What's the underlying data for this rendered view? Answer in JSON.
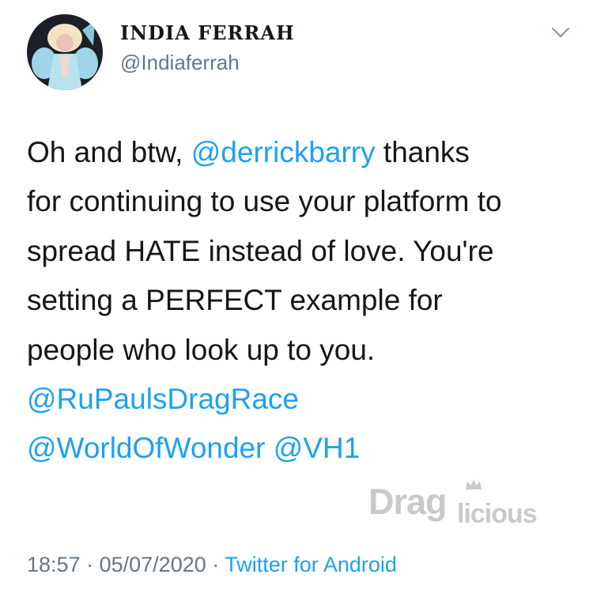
{
  "author": {
    "display_name": "INDIA FERRAH",
    "handle": "@Indiaferrah"
  },
  "tweet": {
    "line1": {
      "before": "Oh and btw, ",
      "mention": "@derrickbarry",
      "after": " thanks"
    },
    "line2": "for continuing to use your platform to",
    "line3": "spread HATE instead of love. You're",
    "line4": "setting a PERFECT example for",
    "line5": "people who look up to you.",
    "line6_mention": "@RuPaulsDragRace",
    "line7_mention_a": "@WorldOfWonder",
    "line7_mention_b": "@VH1"
  },
  "meta": {
    "time": "18:57",
    "date": "05/07/2020",
    "separator": "·",
    "source": "Twitter for Android"
  },
  "watermark": {
    "part1": "Drag",
    "part2": "licious"
  },
  "icons": {
    "chevron": "chevron-down-icon",
    "avatar": "profile-photo"
  },
  "colors": {
    "link": "#1da1f2",
    "secondary": "#657786",
    "text": "#14171a"
  }
}
